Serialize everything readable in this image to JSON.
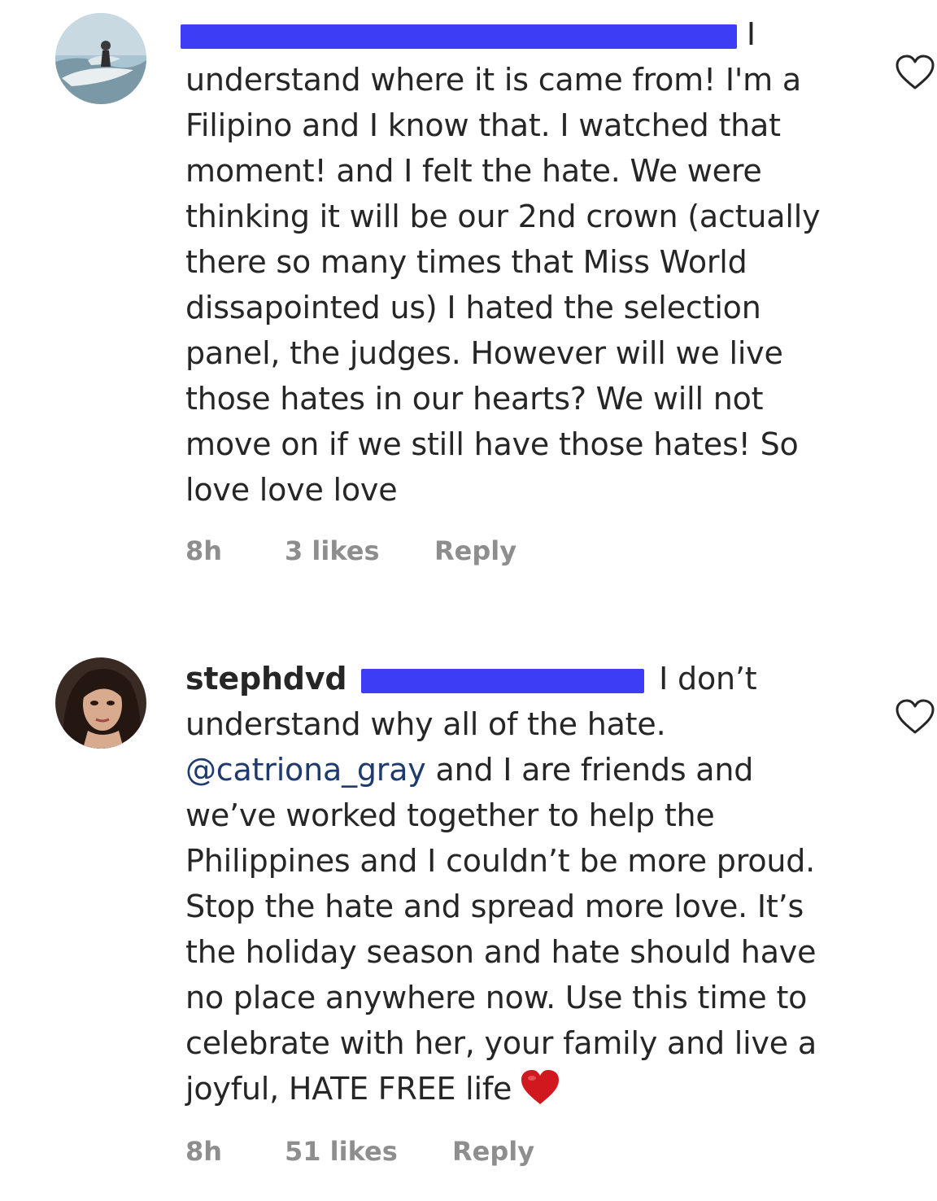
{
  "comments": [
    {
      "username": "",
      "first_line_suffix": "I",
      "lines": [
        "understand where it is came from!  I'm a",
        "Filipino and I know that.  I watched that",
        "moment!  and I felt the hate.  We were",
        "thinking it will be our 2nd crown (actually",
        "there so many times that Miss World",
        "dissapointed us) I hated the selection",
        "panel,  the judges.  However will we live",
        "those hates in our hearts?  We will not",
        "move on if we still have those hates!  So",
        "love love love"
      ],
      "time": "8h",
      "likes": "3 likes",
      "reply": "Reply"
    },
    {
      "username": "stephdvd",
      "first_line_suffix": "I don’t",
      "lines": [
        "understand why all of the hate.",
        "@catriona_gray",
        " and I are friends and",
        "we’ve worked together to help the",
        "Philippines and I couldn’t be more proud.",
        "Stop the hate and spread more love. It’s",
        "the holiday season and hate should have",
        "no place anywhere now. Use this time to",
        "celebrate with her, your family and live a",
        "joyful, HATE FREE life"
      ],
      "time": "8h",
      "likes": "51 likes",
      "reply": "Reply"
    }
  ],
  "icons": {
    "like": "heart-outline-icon",
    "emoji": "red-heart-icon"
  },
  "colors": {
    "text": "#262626",
    "meta": "#8e8e8e",
    "redaction": "#3d3df5",
    "emoji_heart": "#d0181e"
  }
}
